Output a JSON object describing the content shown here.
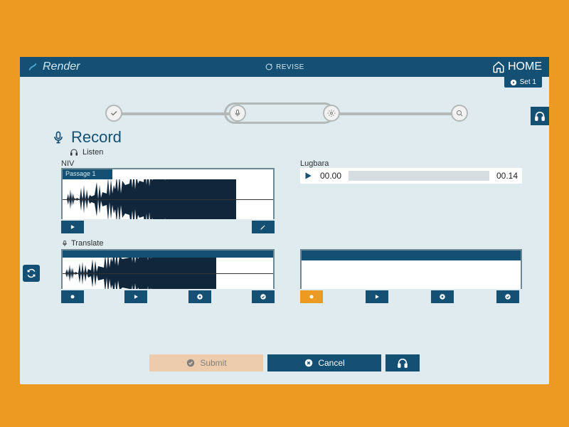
{
  "header": {
    "brand": "Render",
    "revise": "REVISE",
    "home": "HOME",
    "set_label": "Set 1"
  },
  "section": {
    "title": "Record",
    "listen": "Listen",
    "translate": "Translate"
  },
  "source": {
    "label": "NIV",
    "passage": "Passage 1"
  },
  "target": {
    "label": "Lugbara",
    "current_time": "00.00",
    "total_time": "00.14"
  },
  "footer": {
    "submit": "Submit",
    "cancel": "Cancel"
  },
  "colors": {
    "accent": "#144f74",
    "bg": "#dfebef",
    "orange": "#ec9a21"
  }
}
